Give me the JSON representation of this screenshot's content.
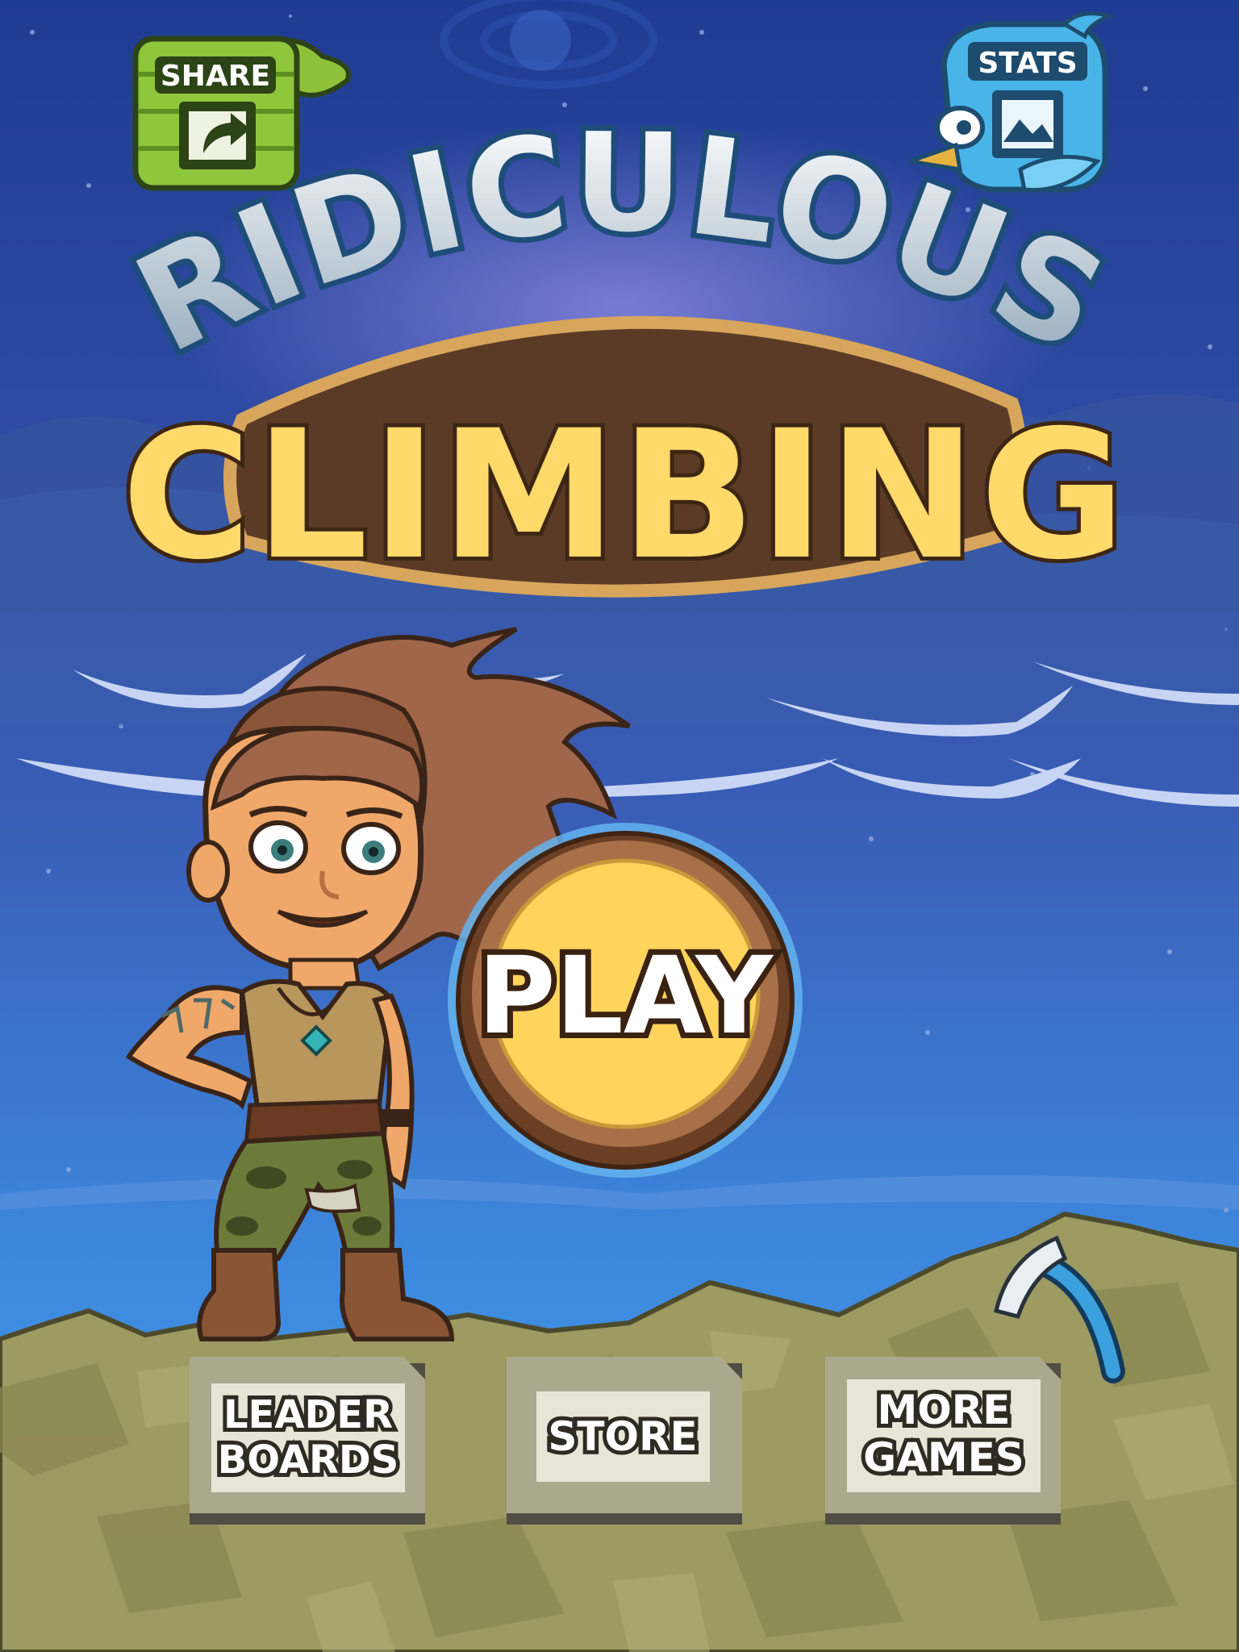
{
  "game": {
    "title_line1": "RIDICULOUS",
    "title_line2": "CLIMBING"
  },
  "buttons": {
    "share": "SHARE",
    "stats": "STATS",
    "play": "PLAY",
    "leaderboards_line1": "LEADER",
    "leaderboards_line2": "BOARDS",
    "store": "STORE",
    "more_games_line1": "MORE",
    "more_games_line2": "GAMES"
  },
  "icons": {
    "share": "share-arrow-icon",
    "stats": "picture-frame-icon",
    "pickaxe": "ice-axe-icon"
  },
  "colors": {
    "sky_top": "#1f3f96",
    "sky_bottom": "#3f9be6",
    "ground": "#9c9a60",
    "title_brown": "#5a3a24",
    "title_yellow": "#ffd96a",
    "play_gold": "#ffd45c",
    "stone": "#d9d7c9"
  }
}
